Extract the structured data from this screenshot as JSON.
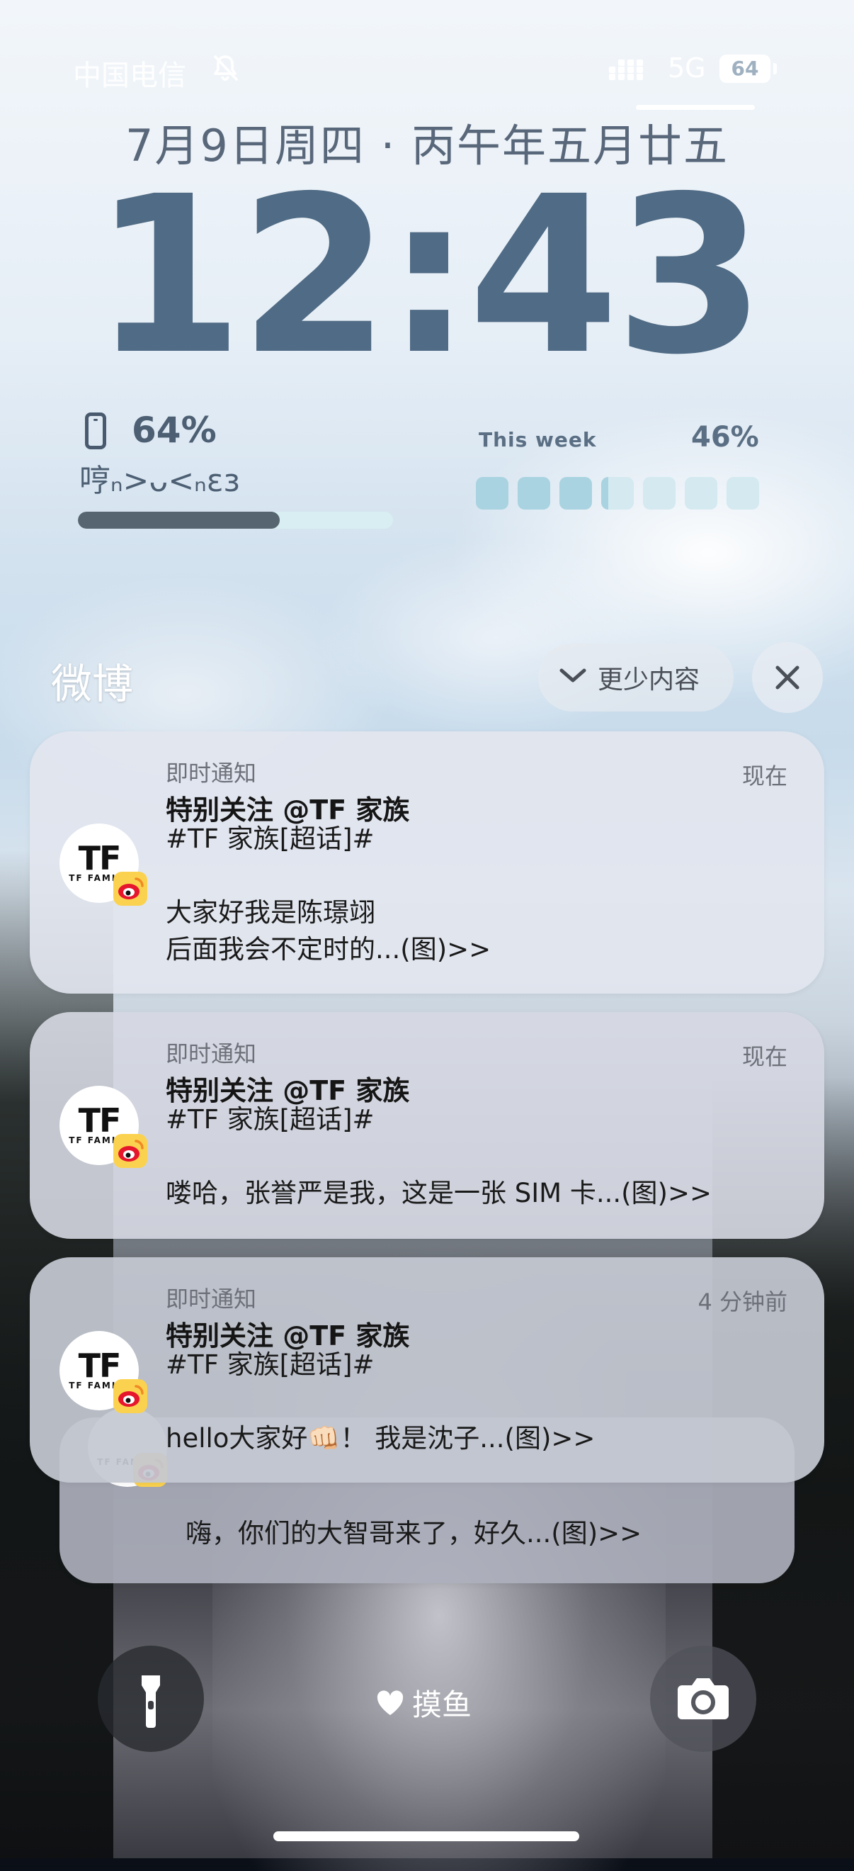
{
  "status_bar": {
    "carrier": "中国电信",
    "network": "5G",
    "battery": "64",
    "icons": [
      "bell-off-icon",
      "signal-icon"
    ]
  },
  "lockscreen": {
    "date": "7月9日周四 · 丙午年五月廿五",
    "time": "12:43"
  },
  "widgets": {
    "battery": {
      "percent_text": "64%",
      "kaomoji": "哼ₙ>ᴗ<ₙεз",
      "level": 0.64
    },
    "week": {
      "label": "This week",
      "percent_text": "46%",
      "progress": 0.46,
      "segments": 7
    }
  },
  "notification_group": {
    "app_name": "微博",
    "show_less_label": "更少内容",
    "show_less_icon": "chevron-down-icon",
    "close_icon": "close-icon"
  },
  "notifications": [
    {
      "type": "即时通知",
      "title": "特别关注 @TF 家族",
      "body": "#TF 家族[超话]#\n\n大家好我是陈璟翊\n后面我会不定时的...(图)>>",
      "time": "现在"
    },
    {
      "type": "即时通知",
      "title": "特别关注 @TF 家族",
      "body": "#TF 家族[超话]#\n\n喽哈，张誉严是我，这是一张 SIM 卡...(图)>>",
      "time": "现在"
    },
    {
      "type": "即时通知",
      "title": "特别关注 @TF 家族",
      "body": "#TF 家族[超话]#\n\nhello大家好👊🏻！ 我是沈子...(图)>>",
      "time": "4 分钟前"
    },
    {
      "body": "嗨，你们的大智哥来了，好久...(图)>>"
    }
  ],
  "avatar": {
    "logo_text": "TF",
    "logo_subtext": "TF FAMILY"
  },
  "bottom": {
    "torch_icon": "flashlight-icon",
    "camera_icon": "camera-icon",
    "center_label": "摸鱼",
    "center_icon": "heart-icon"
  }
}
